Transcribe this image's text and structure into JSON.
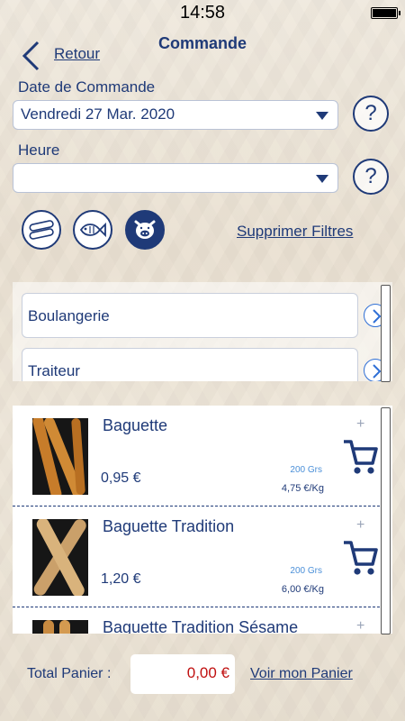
{
  "status": {
    "time": "14:58"
  },
  "header": {
    "back_label": "Retour",
    "title": "Commande"
  },
  "order_date": {
    "label": "Date de Commande",
    "value": "Vendredi 27 Mar. 2020"
  },
  "hour": {
    "label": "Heure",
    "value": ""
  },
  "help_symbol": "?",
  "filters": {
    "icons": [
      "baguette-icon",
      "fish-icon",
      "pig-icon"
    ],
    "clear_label": "Supprimer Filtres"
  },
  "categories": [
    {
      "label": "Boulangerie"
    },
    {
      "label": "Traiteur"
    }
  ],
  "products": [
    {
      "name": "Baguette",
      "price": "0,95 €",
      "weight": "200 Grs",
      "price_per_kg": "4,75 €/Kg"
    },
    {
      "name": "Baguette Tradition",
      "price": "1,20 €",
      "weight": "200 Grs",
      "price_per_kg": "6,00 €/Kg"
    },
    {
      "name": "Baguette Tradition Sésame",
      "price": "",
      "weight": "",
      "price_per_kg": ""
    }
  ],
  "add_symbol": "+",
  "footer": {
    "total_label": "Total Panier :",
    "total_value": "0,00 €",
    "cart_link": "Voir mon Panier"
  },
  "colors": {
    "accent": "#1f3a78",
    "total": "#c01010",
    "weight": "#4a8fd8"
  }
}
